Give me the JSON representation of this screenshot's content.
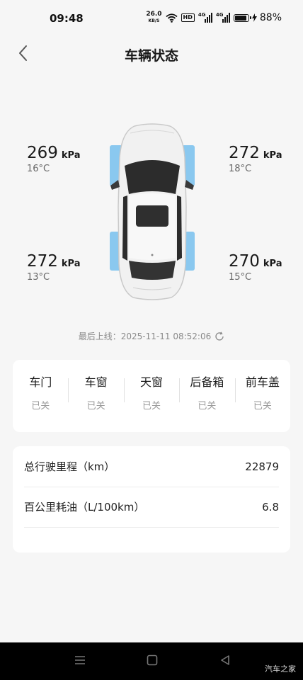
{
  "status_bar": {
    "time": "09:48",
    "net_speed_value": "26.0",
    "net_speed_unit": "KB/S",
    "hd_label": "HD",
    "sim1_label": "4G",
    "sim2_label": "4G",
    "battery_level": 0.88,
    "battery_text": "88%"
  },
  "header": {
    "title": "车辆状态"
  },
  "tires": {
    "front_left": {
      "pressure": "269",
      "unit": "kPa",
      "temp": "16°C"
    },
    "front_right": {
      "pressure": "272",
      "unit": "kPa",
      "temp": "18°C"
    },
    "rear_left": {
      "pressure": "272",
      "unit": "kPa",
      "temp": "13°C"
    },
    "rear_right": {
      "pressure": "270",
      "unit": "kPa",
      "temp": "15°C"
    }
  },
  "last_online": "最后上线：2025-11-11 08:52:06",
  "vehicle_status": [
    {
      "name": "车门",
      "value": "已关"
    },
    {
      "name": "车窗",
      "value": "已关"
    },
    {
      "name": "天窗",
      "value": "已关"
    },
    {
      "name": "后备箱",
      "value": "已关"
    },
    {
      "name": "前车盖",
      "value": "已关"
    }
  ],
  "stats": [
    {
      "label": "总行驶里程（km）",
      "value": "22879"
    },
    {
      "label": "百公里耗油（L/100km）",
      "value": "6.8"
    }
  ],
  "watermark": "汽车之家",
  "colors": {
    "tire_highlight": "#7ec3ee",
    "background": "#f6f6f6",
    "nav_bar": "#000000"
  },
  "icons": [
    "back-icon",
    "refresh-icon",
    "wifi-icon",
    "signal-icon",
    "battery-icon",
    "charging-icon",
    "menu-icon",
    "home-icon",
    "back-triangle-icon"
  ]
}
